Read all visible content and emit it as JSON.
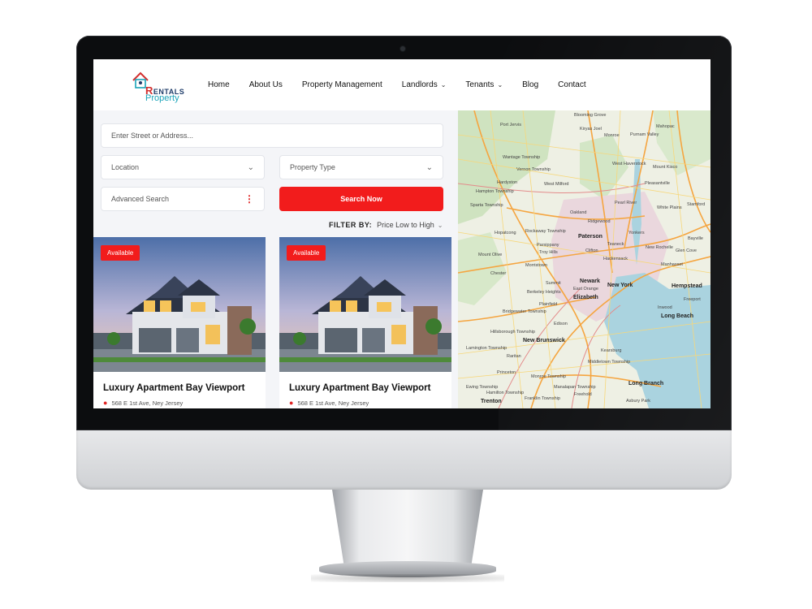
{
  "header": {
    "logo": {
      "brand_word": "Rentals",
      "brand_word_initial": "R",
      "brand_word_rest": "ENTALS",
      "brand_sub": "Property"
    },
    "nav": [
      {
        "label": "Home",
        "dropdown": false
      },
      {
        "label": "About Us",
        "dropdown": false
      },
      {
        "label": "Property Management",
        "dropdown": false
      },
      {
        "label": "Landlords",
        "dropdown": true
      },
      {
        "label": "Tenants",
        "dropdown": true
      },
      {
        "label": "Blog",
        "dropdown": false
      },
      {
        "label": "Contact",
        "dropdown": false
      }
    ]
  },
  "search": {
    "address_placeholder": "Enter Street or Address...",
    "location_label": "Location",
    "property_type_label": "Property Type",
    "advanced_label": "Advanced Search",
    "search_button": "Search Now"
  },
  "filter": {
    "label": "FILTER BY:",
    "value": "Price Low to High"
  },
  "listings": [
    {
      "badge": "Available",
      "title": "Luxury Apartment Bay Viewport",
      "address": "568 E 1st Ave, Ney Jersey"
    },
    {
      "badge": "Available",
      "title": "Luxury Apartment Bay Viewport",
      "address": "568 E 1st Ave, Ney Jersey"
    }
  ],
  "map": {
    "places": [
      "Port Jervis",
      "Blooming Grove",
      "Kiryas Joel",
      "Monroe",
      "Purnam Valley",
      "Mahopac",
      "Vernon Township",
      "Wantage Township",
      "Hardyston",
      "West Haverstock",
      "Mount Kisco",
      "Hampton Township",
      "West Milford",
      "Pearl River",
      "Pleasantville",
      "Sparta Township",
      "Oakland",
      "Ridgewood",
      "White Plains",
      "Stamford",
      "Hopatcong",
      "Rockaway Township",
      "Paterson",
      "Teaneck",
      "Yonkers",
      "Bayville",
      "Parsippany",
      "Clifton",
      "New Rochelle",
      "Glen Cove",
      "Mount Olive",
      "Troy Hills",
      "Hackensack",
      "Morristown",
      "Newark",
      "Manhasset",
      "New York",
      "Hempstead",
      "Chester",
      "Summit",
      "East Orange",
      "Berkeley Heights",
      "Elizabeth",
      "Freeport",
      "Long Beach",
      "Plainfield",
      "Inwood",
      "Bridgewater Township",
      "Edison",
      "Hillsborough Township",
      "New Brunswick",
      "Lamington Township",
      "Kearsburg",
      "Princeton",
      "Middletown Township",
      "Monroe Township",
      "Ewing Township",
      "Manalapan Township",
      "Long Branch",
      "Trenton",
      "Freehold",
      "Asbury Park",
      "Hamilton Township",
      "Franklin Township",
      "Raritan"
    ]
  }
}
